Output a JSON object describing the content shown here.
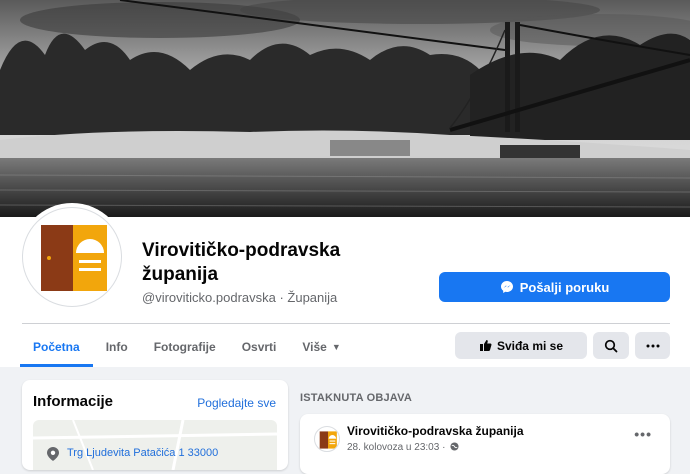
{
  "page": {
    "name": "Virovitičko-podravska županija",
    "handle_line": "@viroviticko.podravska · Županija",
    "message_button": "Pošalji poruku"
  },
  "tabs": [
    {
      "label": "Početna",
      "active": true
    },
    {
      "label": "Info"
    },
    {
      "label": "Fotografije"
    },
    {
      "label": "Osvrti"
    },
    {
      "label": "Više"
    }
  ],
  "actions": {
    "like_label": "Sviđa mi se",
    "search_icon": "search-icon",
    "more_icon": "more-dots-icon"
  },
  "info_card": {
    "title": "Informacije",
    "see_all": "Pogledajte sve",
    "address": "Trg Ljudevita Patačića 1 33000"
  },
  "featured": {
    "label": "ISTAKNUTA OBJAVA",
    "author": "Virovitičko-podravska županija",
    "date": "28. kolovoza u 23:03 ·",
    "more": "•••"
  },
  "colors": {
    "accent": "#1877f2",
    "logo_brown": "#8b3a16",
    "logo_orange": "#f2a60c"
  }
}
